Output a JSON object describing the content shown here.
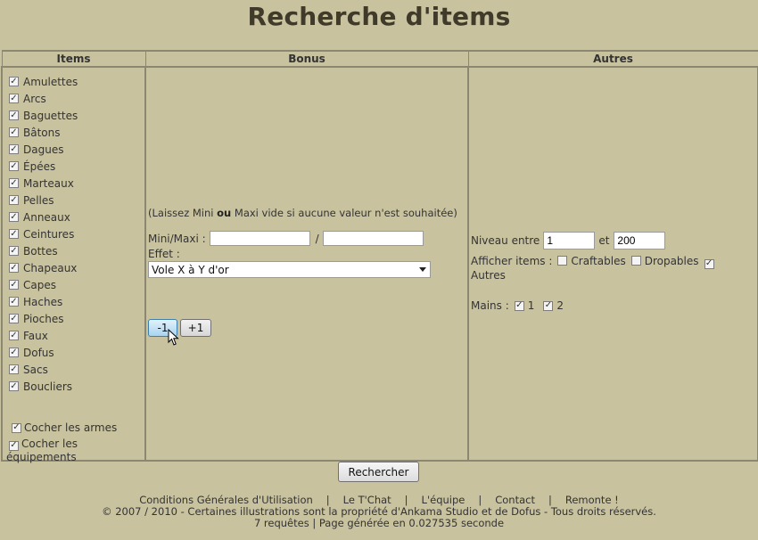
{
  "page": {
    "title": "Recherche d'items"
  },
  "columns": {
    "items": "Items",
    "bonus": "Bonus",
    "autres": "Autres"
  },
  "items": [
    {
      "label": "Amulettes",
      "checked": true
    },
    {
      "label": "Arcs",
      "checked": true
    },
    {
      "label": "Baguettes",
      "checked": true
    },
    {
      "label": "Bâtons",
      "checked": true
    },
    {
      "label": "Dagues",
      "checked": true
    },
    {
      "label": "Épées",
      "checked": true
    },
    {
      "label": "Marteaux",
      "checked": true
    },
    {
      "label": "Pelles",
      "checked": true
    },
    {
      "label": "Anneaux",
      "checked": true
    },
    {
      "label": "Ceintures",
      "checked": true
    },
    {
      "label": "Bottes",
      "checked": true
    },
    {
      "label": "Chapeaux",
      "checked": true
    },
    {
      "label": "Capes",
      "checked": true
    },
    {
      "label": "Haches",
      "checked": true
    },
    {
      "label": "Pioches",
      "checked": true
    },
    {
      "label": "Faux",
      "checked": true
    },
    {
      "label": "Dofus",
      "checked": true
    },
    {
      "label": "Sacs",
      "checked": true
    },
    {
      "label": "Boucliers",
      "checked": true
    }
  ],
  "toggles": {
    "armes": "Cocher les armes",
    "equipements_1": "Cocher les",
    "equipements_2": "équipements"
  },
  "bonus": {
    "note_pre": "(Laissez Mini ",
    "note_bold": "ou",
    "note_post": " Maxi vide si aucune valeur n'est souhaitée)",
    "minimaxi_label": "Mini/Maxi :",
    "mini_value": "",
    "slash": "/",
    "maxi_value": "",
    "effet_label": "Effet :",
    "effet_selected": "Vole X à Y d'or",
    "minus_label": "-1",
    "plus_label": "+1"
  },
  "autres": {
    "niveau_label": "Niveau entre",
    "niveau_min": "1",
    "et_label": "et",
    "niveau_max": "200",
    "afficher_label": "Afficher items :",
    "craftables_label": "Craftables",
    "craftables_checked": false,
    "dropables_label": "Dropables",
    "dropables_checked": false,
    "autres_label": "Autres",
    "autres_checked": true,
    "mains_label": "Mains :",
    "mains_1": "1",
    "mains_2": "2"
  },
  "search_button": "Rechercher",
  "footer": {
    "links": [
      "Conditions Générales d'Utilisation",
      "Le T'Chat",
      "L'équipe",
      "Contact",
      "Remonte !"
    ],
    "sep": "|",
    "copyright": "© 2007 / 2010 - Certaines illustrations sont la propriété d'Ankama Studio et de Dofus - Tous droits réservés.",
    "stats": "7 requêtes | Page générée en 0.027535 seconde"
  }
}
